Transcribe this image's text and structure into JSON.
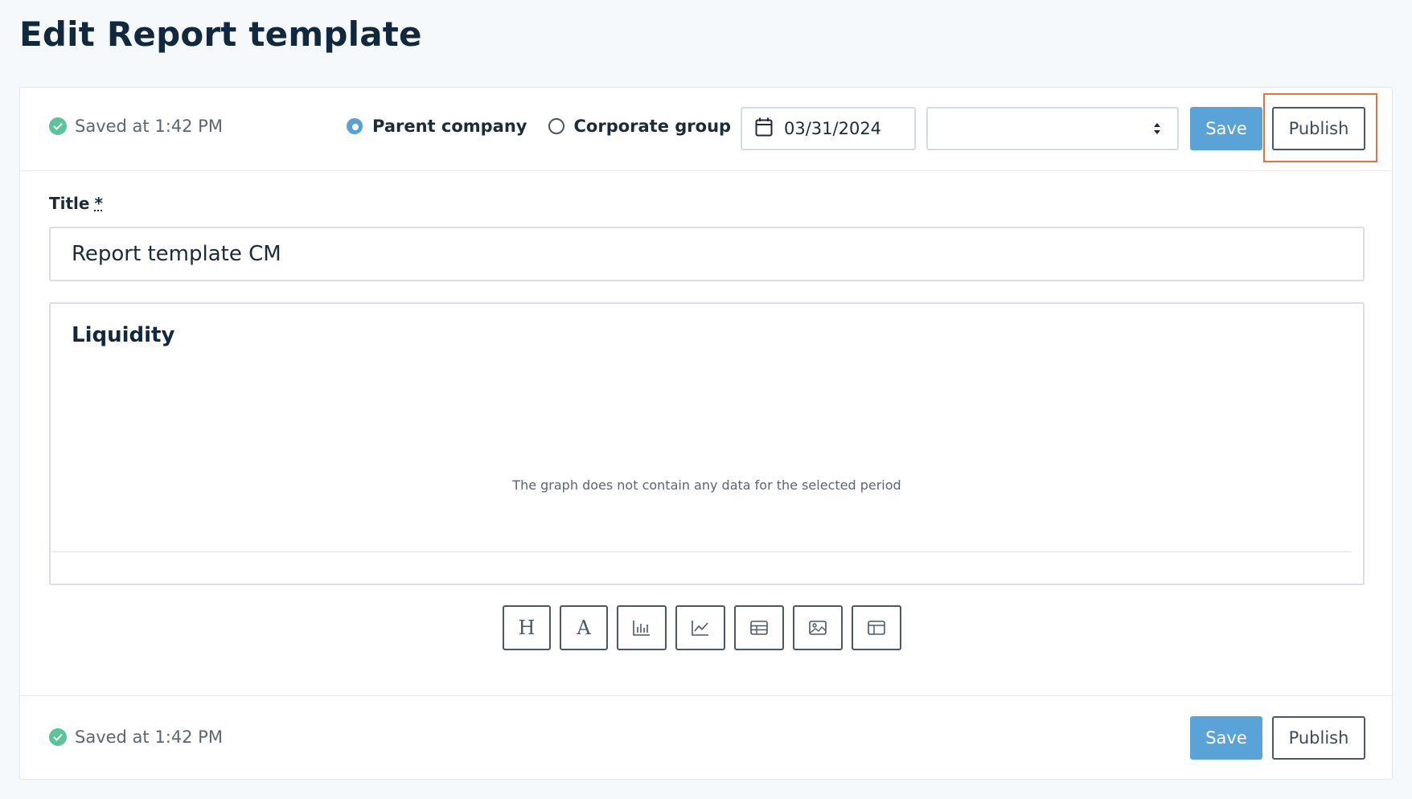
{
  "page": {
    "title": "Edit Report template"
  },
  "toolbar": {
    "saved_status": "Saved at 1:42 PM",
    "radio_options": [
      {
        "label": "Parent company",
        "checked": true
      },
      {
        "label": "Corporate group",
        "checked": false
      }
    ],
    "date_value": "03/31/2024",
    "select_value": "",
    "save_label": "Save",
    "publish_label": "Publish"
  },
  "form": {
    "title_label": "Title",
    "required_mark": "*",
    "title_value": "Report template CM"
  },
  "block": {
    "heading": "Liquidity",
    "empty_message": "The graph does not contain any data for the selected period"
  },
  "insert_tools": [
    {
      "icon": "heading-icon",
      "glyph": "H"
    },
    {
      "icon": "text-icon",
      "glyph": "A"
    },
    {
      "icon": "bar-chart-icon"
    },
    {
      "icon": "line-chart-icon"
    },
    {
      "icon": "table-icon"
    },
    {
      "icon": "image-icon"
    },
    {
      "icon": "layout-icon"
    }
  ],
  "footer": {
    "saved_status": "Saved at 1:42 PM",
    "save_label": "Save",
    "publish_label": "Publish"
  },
  "colors": {
    "primary": "#5aa3d8",
    "success": "#5cc39a",
    "highlight": "#e8703a"
  }
}
